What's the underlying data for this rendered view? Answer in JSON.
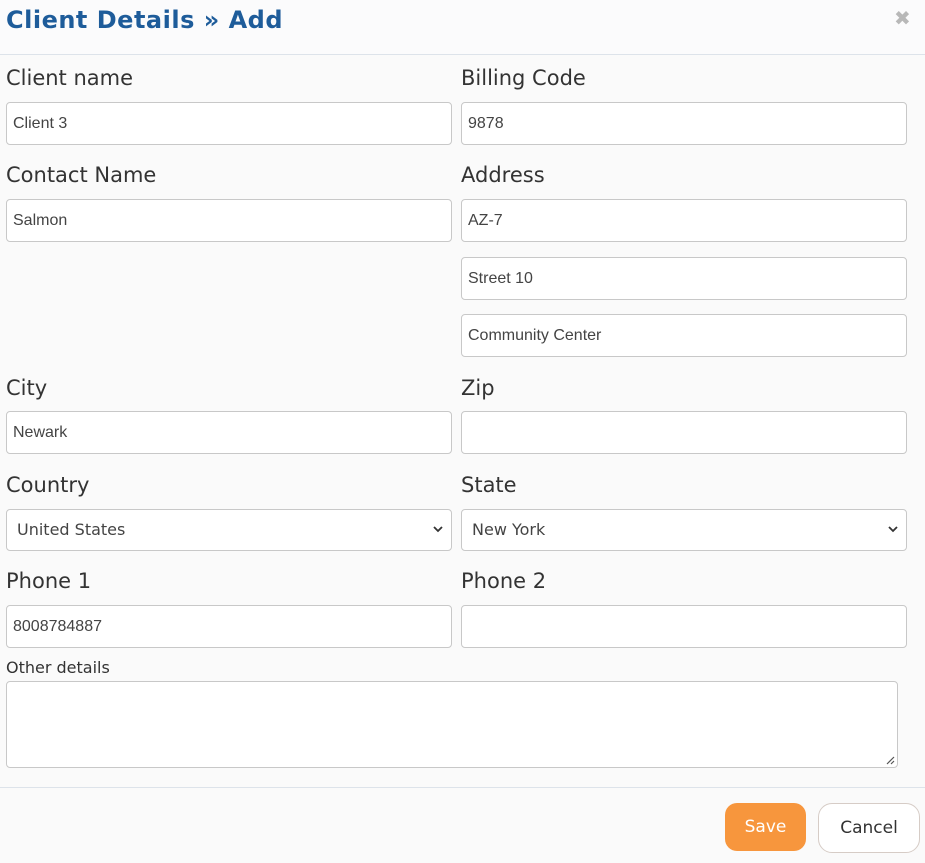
{
  "header": {
    "title": "Client Details » Add",
    "close_icon": "close-x-icon"
  },
  "form": {
    "client_name": {
      "label": "Client name",
      "value": "Client 3"
    },
    "billing_code": {
      "label": "Billing Code",
      "value": "9878"
    },
    "contact_name": {
      "label": "Contact Name",
      "value": "Salmon"
    },
    "address": {
      "label": "Address",
      "line1": "AZ-7",
      "line2": "Street 10",
      "line3": "Community Center"
    },
    "city": {
      "label": "City",
      "value": "Newark"
    },
    "zip": {
      "label": "Zip",
      "value": ""
    },
    "country": {
      "label": "Country",
      "selected": "United States"
    },
    "state": {
      "label": "State",
      "selected": "New York"
    },
    "phone1": {
      "label": "Phone 1",
      "value": "8008784887"
    },
    "phone2": {
      "label": "Phone 2",
      "value": ""
    },
    "other_details": {
      "label": "Other details",
      "value": ""
    }
  },
  "footer": {
    "save_label": "Save",
    "cancel_label": "Cancel"
  },
  "colors": {
    "title": "#1e5c9a",
    "save_button": "#f7963d"
  }
}
